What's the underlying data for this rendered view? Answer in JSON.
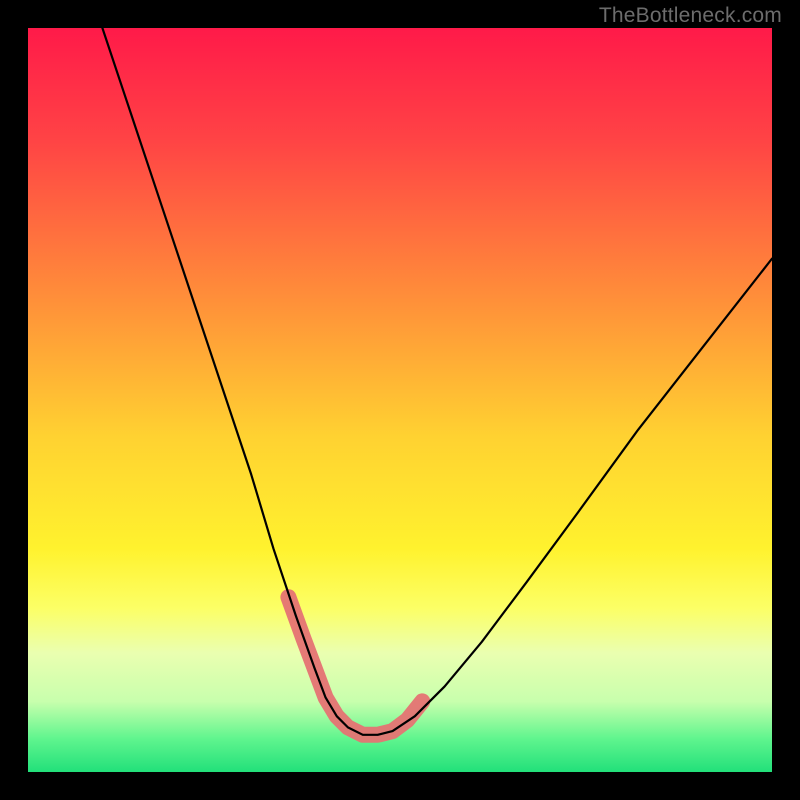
{
  "watermark": "TheBottleneck.com",
  "chart_data": {
    "type": "line",
    "title": "",
    "xlabel": "",
    "ylabel": "",
    "xlim": [
      0,
      100
    ],
    "ylim": [
      0,
      100
    ],
    "note": "Unlabeled bottleneck V-curve over a red→green vertical gradient. Values below are estimated from pixel positions; no explicit axis ticks are rendered in the source image.",
    "gradient_stops": [
      {
        "offset": 0.0,
        "color": "#ff1a49"
      },
      {
        "offset": 0.15,
        "color": "#ff4345"
      },
      {
        "offset": 0.35,
        "color": "#ff8a3a"
      },
      {
        "offset": 0.55,
        "color": "#ffd231"
      },
      {
        "offset": 0.7,
        "color": "#fff22e"
      },
      {
        "offset": 0.78,
        "color": "#fcff66"
      },
      {
        "offset": 0.84,
        "color": "#eaffb0"
      },
      {
        "offset": 0.905,
        "color": "#c8ffad"
      },
      {
        "offset": 0.955,
        "color": "#60f58e"
      },
      {
        "offset": 1.0,
        "color": "#22e07a"
      }
    ],
    "series": [
      {
        "name": "bottleneck-curve",
        "x": [
          10.0,
          14.0,
          18.0,
          22.0,
          26.0,
          30.0,
          33.0,
          36.0,
          38.5,
          40.0,
          41.5,
          43.0,
          45.0,
          47.0,
          49.0,
          52.0,
          56.0,
          61.0,
          67.0,
          74.0,
          82.0,
          91.0,
          100.0
        ],
        "y": [
          100.0,
          88.0,
          76.0,
          64.0,
          52.0,
          40.0,
          30.0,
          21.0,
          14.0,
          10.0,
          7.5,
          6.0,
          5.0,
          5.0,
          5.5,
          7.5,
          11.5,
          17.5,
          25.5,
          35.0,
          46.0,
          57.5,
          69.0
        ]
      },
      {
        "name": "highlight-band",
        "note": "Thick salmon-colored stroke over the trough region of the curve.",
        "x": [
          35.0,
          37.0,
          38.5,
          40.0,
          41.5,
          43.0,
          45.0,
          47.0,
          49.0,
          51.0,
          53.0
        ],
        "y": [
          23.5,
          18.0,
          14.0,
          10.0,
          7.5,
          6.0,
          5.0,
          5.0,
          5.5,
          7.0,
          9.5
        ]
      }
    ],
    "colors": {
      "curve": "#000000",
      "highlight": "#e57373",
      "background_frame": "#000000"
    }
  }
}
